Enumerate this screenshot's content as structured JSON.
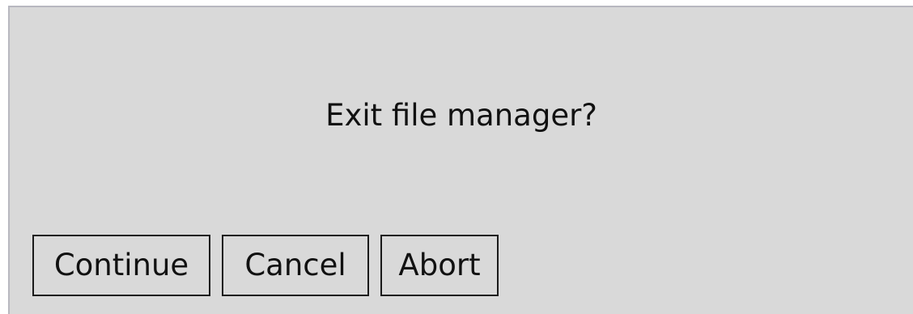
{
  "dialog": {
    "message": "Exit file manager?",
    "buttons": {
      "continue_label": "Continue",
      "cancel_label": "Cancel",
      "abort_label": "Abort"
    }
  },
  "colors": {
    "dialog_background": "#d9d9d9",
    "text": "#111111",
    "button_border": "#1a1a1a"
  }
}
